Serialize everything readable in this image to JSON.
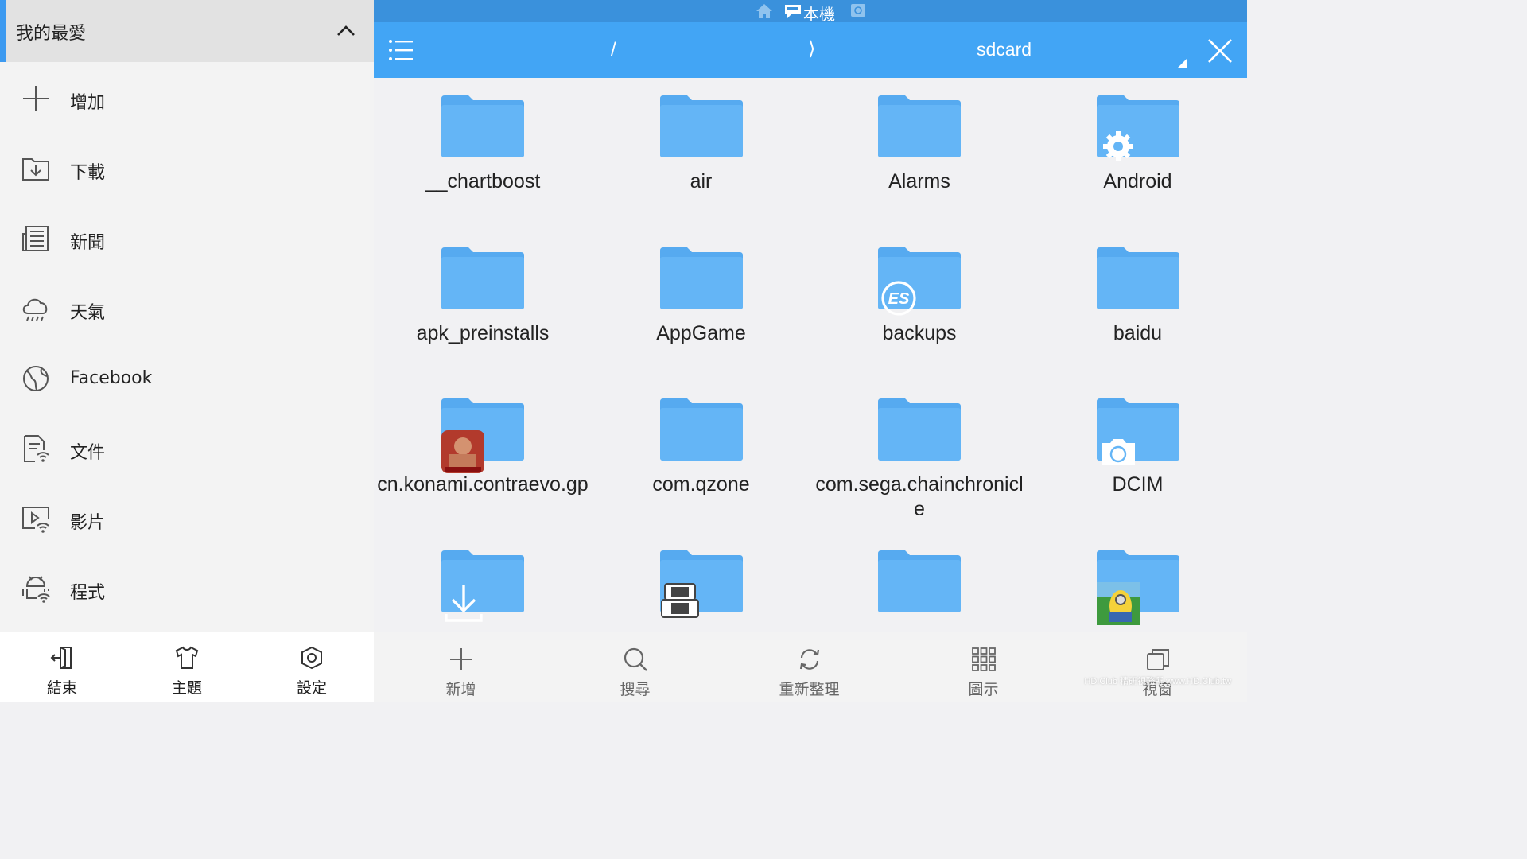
{
  "drawer": {
    "title": "我的最愛",
    "items": [
      {
        "label": "增加",
        "icon": "plus-icon"
      },
      {
        "label": "下載",
        "icon": "download-folder-icon"
      },
      {
        "label": "新聞",
        "icon": "news-icon"
      },
      {
        "label": "天氣",
        "icon": "weather-icon"
      },
      {
        "label": "Facebook",
        "icon": "globe-icon"
      },
      {
        "label": "文件",
        "icon": "document-icon"
      },
      {
        "label": "影片",
        "icon": "video-icon"
      },
      {
        "label": "程式",
        "icon": "app-icon"
      }
    ],
    "bottom": [
      {
        "label": "結束",
        "icon": "exit-icon"
      },
      {
        "label": "主題",
        "icon": "shirt-icon"
      },
      {
        "label": "設定",
        "icon": "settings-icon"
      }
    ]
  },
  "top_strip": {
    "location_label": "本機"
  },
  "pathbar": {
    "root": "/",
    "separator": "⟩",
    "current": "sdcard"
  },
  "folders": [
    {
      "name": "__chartboost"
    },
    {
      "name": "air"
    },
    {
      "name": "Alarms"
    },
    {
      "name": "Android",
      "badge": "settings-gear-badge"
    },
    {
      "name": "apk_preinstalls"
    },
    {
      "name": "AppGame"
    },
    {
      "name": "backups",
      "badge": "es-logo-badge"
    },
    {
      "name": "baidu"
    },
    {
      "name": "cn.konami.contraevo.gp",
      "badge": "game-app-badge"
    },
    {
      "name": "com.qzone"
    },
    {
      "name": "com.sega.chainchronicle"
    },
    {
      "name": "DCIM",
      "badge": "camera-badge"
    },
    {
      "name": "",
      "badge": "download-arrow-badge"
    },
    {
      "name": "",
      "badge": "ds-device-badge"
    },
    {
      "name": ""
    },
    {
      "name": "",
      "badge": "minion-app-badge"
    }
  ],
  "toolbar": [
    {
      "label": "新增",
      "icon": "plus-icon"
    },
    {
      "label": "搜尋",
      "icon": "search-icon"
    },
    {
      "label": "重新整理",
      "icon": "refresh-icon"
    },
    {
      "label": "圖示",
      "icon": "grid-view-icon"
    },
    {
      "label": "視窗",
      "icon": "windows-icon"
    }
  ],
  "watermark": "HD.Club 精研視務所 www.HD.Club.tw",
  "colors": {
    "accent": "#42a5f5",
    "strip": "#3a91dc",
    "folder": "#64b5f6",
    "folder_tab": "#56aaf0"
  }
}
